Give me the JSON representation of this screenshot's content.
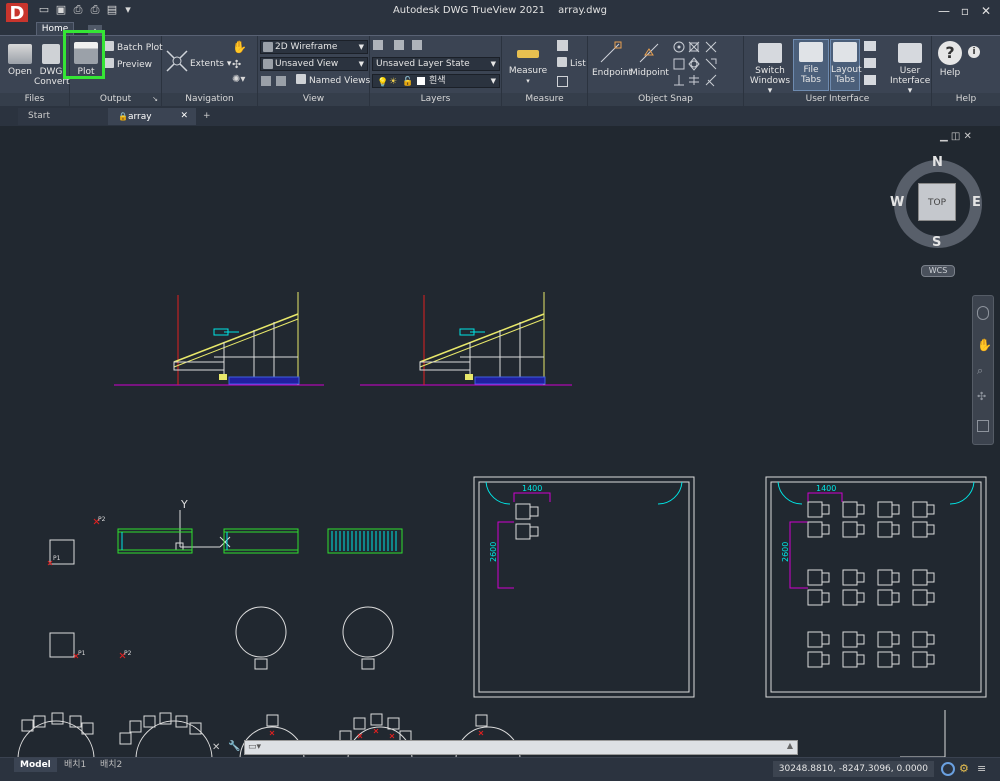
{
  "window": {
    "app_title": "Autodesk DWG TrueView 2021",
    "file_name": "array.dwg",
    "logo_letter": "D",
    "minimize_icon": "minimize-icon",
    "maximize_icon": "maximize-icon",
    "close_icon": "close-icon"
  },
  "ribbon": {
    "active_tab": "Home",
    "panels": {
      "files": {
        "title": "Files",
        "open": "Open",
        "convert_line1": "DWG",
        "convert_line2": "Convert"
      },
      "output": {
        "title": "Output",
        "plot": "Plot",
        "batch_plot": "Batch Plot",
        "preview": "Preview"
      },
      "navigation": {
        "title": "Navigation",
        "extents": "Extents"
      },
      "view": {
        "title": "View",
        "visual_style": "2D Wireframe",
        "saved_view": "Unsaved View",
        "named_views": "Named Views"
      },
      "layers": {
        "title": "Layers",
        "layer_state": "Unsaved Layer State",
        "current_layer": "흰색"
      },
      "measure": {
        "title": "Measure",
        "measure": "Measure",
        "list": "List"
      },
      "object_snap": {
        "title": "Object Snap",
        "endpoint": "Endpoint",
        "midpoint": "Midpoint"
      },
      "user_interface": {
        "title": "User Interface",
        "switch_line1": "Switch",
        "switch_line2": "Windows",
        "file_tabs": "File Tabs",
        "layout_line1": "Layout",
        "layout_line2": "Tabs",
        "ui_line1": "User",
        "ui_line2": "Interface"
      },
      "help": {
        "title": "Help",
        "help": "Help"
      }
    }
  },
  "file_tabs": {
    "start": "Start",
    "array": "array",
    "add_icon": "plus-icon"
  },
  "viewcube": {
    "n": "N",
    "s": "S",
    "e": "E",
    "w": "W",
    "top": "TOP",
    "wcs": "WCS"
  },
  "drawing": {
    "y_label": "Y",
    "p1": "P1",
    "p2": "P2",
    "dim_1400": "1400",
    "dim_2600": "2600"
  },
  "layout_tabs": [
    "Model",
    "배치1",
    "배치2"
  ],
  "status": {
    "coords": "30248.8810, -8247.3096, 0.0000"
  },
  "colors": {
    "background": "#212830",
    "ribbon": "#3b4453",
    "highlight": "#35e535",
    "cyan": "#00e5e5",
    "magenta": "#d000d0",
    "yellow": "#e8e86a",
    "green": "#2ee02e"
  }
}
